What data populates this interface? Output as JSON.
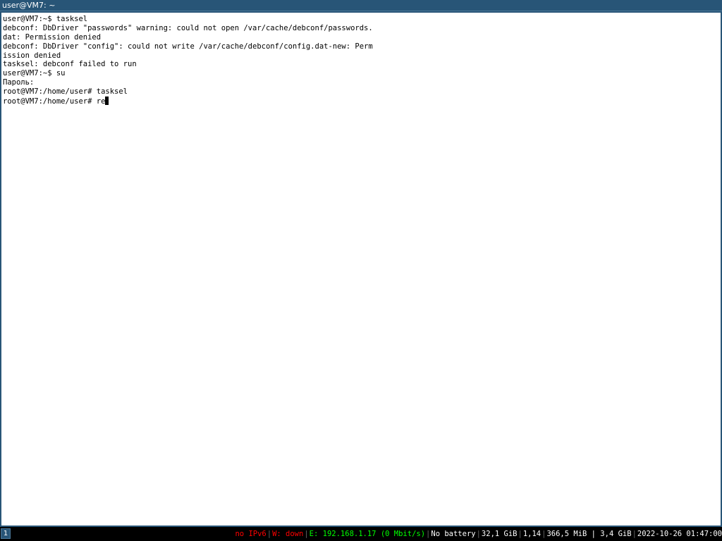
{
  "window": {
    "title": "user@VM7: ~"
  },
  "terminal": {
    "lines": [
      "user@VM7:~$ tasksel",
      "debconf: DbDriver \"passwords\" warning: could not open /var/cache/debconf/passwords.",
      "dat: Permission denied",
      "debconf: DbDriver \"config\": could not write /var/cache/debconf/config.dat-new: Perm",
      "ission denied",
      "tasksel: debconf failed to run",
      "user@VM7:~$ su",
      "Пароль:",
      "root@VM7:/home/user# tasksel",
      "root@VM7:/home/user# re"
    ]
  },
  "statusbar": {
    "workspace": "1",
    "ipv6": "no IPv6",
    "wireless": "W: down",
    "ethernet": "E: 192.168.1.17 (0 Mbit/s)",
    "battery": "No battery",
    "disk": "32,1 GiB",
    "load": "1,14",
    "memory": "366,5 MiB | 3,4 GiB",
    "datetime": "2022-10-26 01:47:00",
    "colors": {
      "bad": "#ff0000",
      "good": "#00ff00",
      "normal": "#ffffff",
      "separator": "#666666",
      "focused_workspace": "#285577"
    }
  }
}
